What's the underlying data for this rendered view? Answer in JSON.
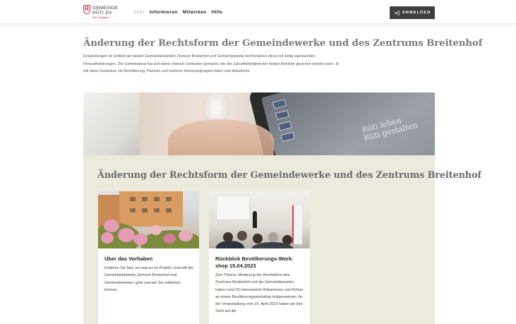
{
  "header": {
    "logo": {
      "mark": "R",
      "line1": "GEMEINDE",
      "line2": "RÜTI ZH",
      "tagline": "Rüti. Gestalten."
    },
    "nav": [
      {
        "label": "Start",
        "active": true
      },
      {
        "label": "Informieren",
        "active": false
      },
      {
        "label": "Mitwirken",
        "active": false
      },
      {
        "label": "Hilfe",
        "active": false
      }
    ],
    "login_label": "ANMELDEN",
    "login_icon": "login-arrow-icon"
  },
  "page": {
    "title": "Änderung der Rechtsform der Gemeindewerke und des Zentrums Breitenhof",
    "intro": "Entwicklungen im Umfeld der beiden Gemeindebetriebe Zentrum Breitenhof und Gemeindewerke konfrontieren diese mit stetig wachsenden Herausforderungen. Der Gemeinderat hat sich daher intensiv Gedanken gemacht, wie die Zukunftsfähigkeit der beiden Betriebe gesichert werden kann. Er will diese Gedanken mit Bevölkerung, Parteien und weiteren Interessegruppen teilen und diskutieren."
  },
  "hero": {
    "slogan_line1": "Rüti leben",
    "slogan_line2": "Rüti gestalten"
  },
  "section": {
    "title": "Änderung der Rechtsform der Gemeindewerke und des Zentrums Breitenhof",
    "background": "#eceadd",
    "cards": [
      {
        "title": "Über das Vorhaben",
        "text": "Erfahren Sie hier, um was es im Projekt «Zukunft der Gemeindebetriebe Zentrum Breitenhof und Gemeindewerke» geht und wie Sie mitwirken können."
      },
      {
        "title": "Rückblick Bevölkerungs-Work-shop 15.04.2023",
        "text": "Zum Thema «Änderung der Rechtsform des Zentrums Breitenhof und der Gemeindewerke» haben rund 25 interessierte Rütnerinnen und Rütner an einem Bevölkerungsworkshop teilgenommen. An der Veranstaltung vom 15. April 2023 haben sie ihre Sicht auf die"
      }
    ]
  },
  "colors": {
    "brand_red": "#c8242f",
    "button_dark": "#3f3f3f"
  }
}
